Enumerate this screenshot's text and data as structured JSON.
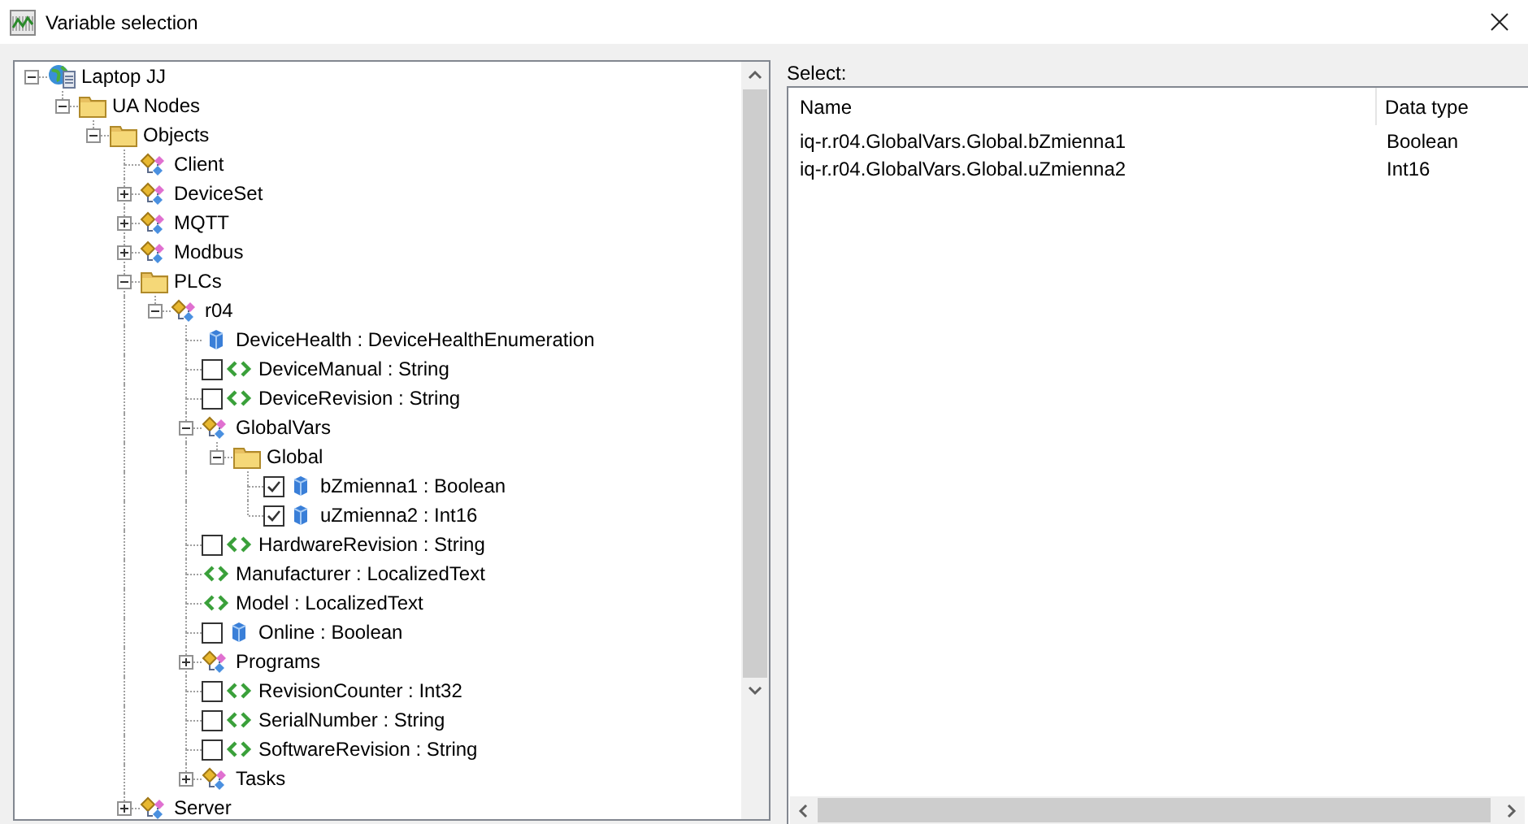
{
  "window": {
    "title": "Variable selection"
  },
  "tree": [
    {
      "label": "Laptop JJ",
      "kind": "server",
      "expanded": true,
      "children": [
        {
          "label": "UA Nodes",
          "kind": "folder",
          "expanded": true,
          "children": [
            {
              "label": "Objects",
              "kind": "folder",
              "expanded": true,
              "children": [
                {
                  "label": "Client",
                  "kind": "object"
                },
                {
                  "label": "DeviceSet",
                  "kind": "object",
                  "expanded": false
                },
                {
                  "label": "MQTT",
                  "kind": "object",
                  "expanded": false
                },
                {
                  "label": "Modbus",
                  "kind": "object",
                  "expanded": false
                },
                {
                  "label": "PLCs",
                  "kind": "folder",
                  "expanded": true,
                  "children": [
                    {
                      "label": "r04",
                      "kind": "object",
                      "expanded": true,
                      "children": [
                        {
                          "label": "DeviceHealth : DeviceHealthEnumeration",
                          "kind": "variable"
                        },
                        {
                          "label": "DeviceManual : String",
                          "kind": "property",
                          "checked": false
                        },
                        {
                          "label": "DeviceRevision : String",
                          "kind": "property",
                          "checked": false
                        },
                        {
                          "label": "GlobalVars",
                          "kind": "object",
                          "expanded": true,
                          "children": [
                            {
                              "label": "Global",
                              "kind": "folder",
                              "expanded": true,
                              "children": [
                                {
                                  "label": "bZmienna1 : Boolean",
                                  "kind": "variable",
                                  "checked": true
                                },
                                {
                                  "label": "uZmienna2 : Int16",
                                  "kind": "variable",
                                  "checked": true
                                }
                              ]
                            }
                          ]
                        },
                        {
                          "label": "HardwareRevision : String",
                          "kind": "property",
                          "checked": false
                        },
                        {
                          "label": "Manufacturer : LocalizedText",
                          "kind": "property"
                        },
                        {
                          "label": "Model : LocalizedText",
                          "kind": "property"
                        },
                        {
                          "label": "Online : Boolean",
                          "kind": "variable",
                          "checked": false
                        },
                        {
                          "label": "Programs",
                          "kind": "object",
                          "expanded": false
                        },
                        {
                          "label": "RevisionCounter : Int32",
                          "kind": "property",
                          "checked": false
                        },
                        {
                          "label": "SerialNumber : String",
                          "kind": "property",
                          "checked": false
                        },
                        {
                          "label": "SoftwareRevision : String",
                          "kind": "property",
                          "checked": false
                        },
                        {
                          "label": "Tasks",
                          "kind": "object",
                          "expanded": false
                        }
                      ]
                    }
                  ]
                },
                {
                  "label": "Server",
                  "kind": "object",
                  "expanded": false
                }
              ]
            }
          ]
        }
      ]
    }
  ],
  "select": {
    "label": "Select:",
    "columns": [
      "Name",
      "Data type"
    ],
    "rows": [
      {
        "name": "iq-r.r04.GlobalVars.Global.bZmienna1",
        "data_type": "Boolean"
      },
      {
        "name": "iq-r.r04.GlobalVars.Global.uZmienna2",
        "data_type": "Int16"
      }
    ]
  }
}
